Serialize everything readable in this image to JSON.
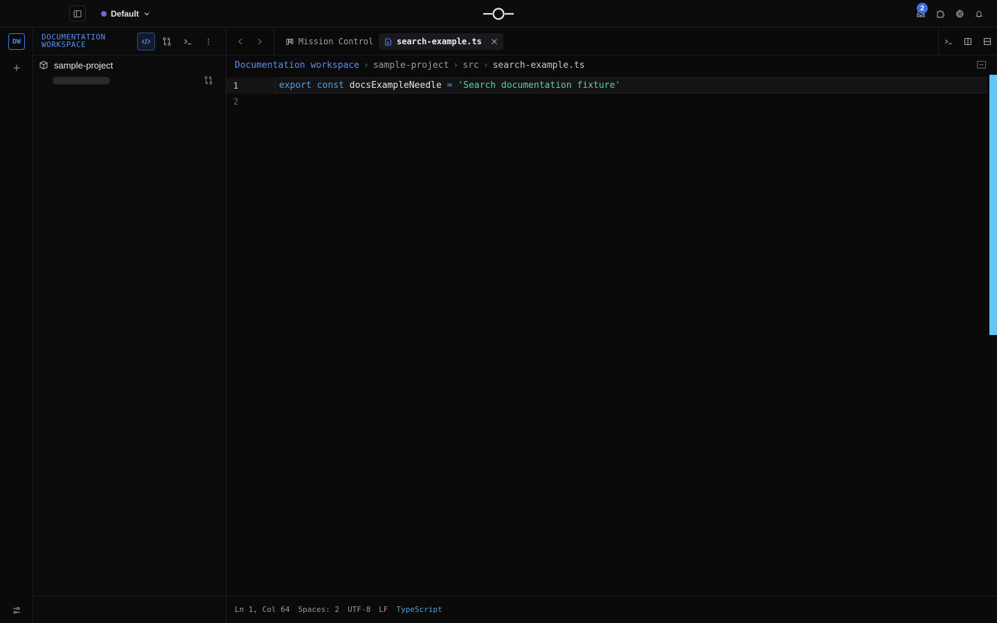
{
  "topbar": {
    "profile_name": "Default",
    "notifications_count": "2"
  },
  "rail": {
    "workspace_initials": "DW"
  },
  "sidebar": {
    "title": "DOCUMENTATION WORKSPACE",
    "project_name": "sample-project"
  },
  "tabs": {
    "mission_control": "Mission Control",
    "active_file": "search-example.ts"
  },
  "breadcrumb": {
    "root": "Documentation workspace",
    "sep": "›",
    "project": "sample-project",
    "folder": "src",
    "file": "search-example.ts"
  },
  "code": {
    "lines": [
      {
        "num": "1",
        "kw1": "export",
        "kw2": "const",
        "ident": "docsExampleNeedle",
        "op": "=",
        "str": "'Search documentation fixture'"
      },
      {
        "num": "2"
      }
    ]
  },
  "status": {
    "position": "Ln 1, Col 64",
    "spaces": "Spaces: 2",
    "encoding": "UTF-8",
    "eol": "LF",
    "language": "TypeScript"
  },
  "colors": {
    "accent": "#4b8bf5",
    "keyword": "#4ea3e0",
    "string": "#5fd0a0",
    "scrollbar": "#66c4f2",
    "profile_dot": "#7b61d6"
  }
}
